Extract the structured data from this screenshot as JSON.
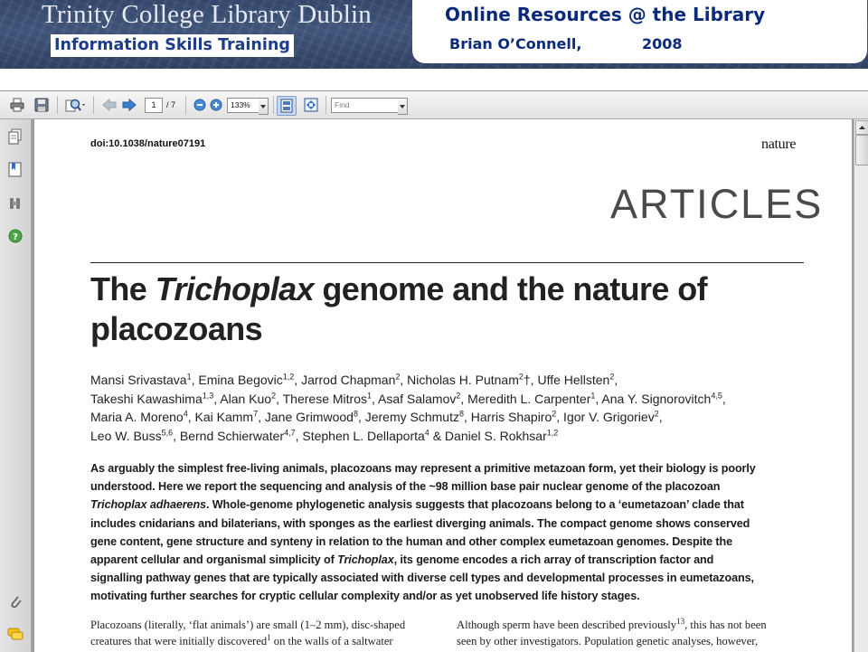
{
  "banner": {
    "title": "Trinity College Library Dublin",
    "subtitle": "Information Skills Training",
    "course_title": "Online Resources @ the Library",
    "author": "Brian O’Connell,",
    "year": "2008"
  },
  "toolbar": {
    "current_page": "1",
    "page_total": "/ 7",
    "zoom": "133%",
    "find_placeholder": "Find"
  },
  "sidebar": {
    "icons": [
      "pages-icon",
      "bookmarks-icon",
      "signatures-icon",
      "help-icon",
      "attachments-icon",
      "comments-icon"
    ]
  },
  "article": {
    "doi": "doi:10.1038/nature07191",
    "journal": "nature",
    "section": "ARTICLES",
    "title_1": "The ",
    "title_italic": "Trichoplax",
    "title_2": " genome and the nature of",
    "title_3": "placozoans",
    "authors": [
      [
        {
          "t": "Mansi Srivastava"
        },
        {
          "s": "1"
        },
        {
          "t": ", Emina Begovic"
        },
        {
          "s": "1,2"
        },
        {
          "t": ", Jarrod Chapman"
        },
        {
          "s": "2"
        },
        {
          "t": ", Nicholas H. Putnam"
        },
        {
          "s": "2"
        },
        {
          "t": "†, Uffe Hellsten"
        },
        {
          "s": "2"
        },
        {
          "t": ","
        }
      ],
      [
        {
          "t": "Takeshi Kawashima"
        },
        {
          "s": "1,3"
        },
        {
          "t": ", Alan Kuo"
        },
        {
          "s": "2"
        },
        {
          "t": ", Therese Mitros"
        },
        {
          "s": "1"
        },
        {
          "t": ", Asaf Salamov"
        },
        {
          "s": "2"
        },
        {
          "t": ", Meredith L. Carpenter"
        },
        {
          "s": "1"
        },
        {
          "t": ", Ana Y. Signorovitch"
        },
        {
          "s": "4,5"
        },
        {
          "t": ","
        }
      ],
      [
        {
          "t": "Maria A. Moreno"
        },
        {
          "s": "4"
        },
        {
          "t": ", Kai Kamm"
        },
        {
          "s": "7"
        },
        {
          "t": ", Jane Grimwood"
        },
        {
          "s": "8"
        },
        {
          "t": ", Jeremy Schmutz"
        },
        {
          "s": "8"
        },
        {
          "t": ", Harris Shapiro"
        },
        {
          "s": "2"
        },
        {
          "t": ", Igor V. Grigoriev"
        },
        {
          "s": "2"
        },
        {
          "t": ","
        }
      ],
      [
        {
          "t": "Leo W. Buss"
        },
        {
          "s": "5,6"
        },
        {
          "t": ", Bernd Schierwater"
        },
        {
          "s": "4,7"
        },
        {
          "t": ", Stephen L. Dellaporta"
        },
        {
          "s": "4"
        },
        {
          "t": " & Daniel S. Rokhsar"
        },
        {
          "s": "1,2"
        }
      ]
    ],
    "abstract_lines": [
      [
        {
          "t": "As arguably the simplest free-living animals, placozoans may represent a primitive metazoan form, yet their biology is poorly"
        }
      ],
      [
        {
          "t": "understood. Here we report the sequencing and analysis of the ~98 million base pair nuclear genome of the placozoan"
        }
      ],
      [
        {
          "i": "Trichoplax adhaerens"
        },
        {
          "t": ". Whole-genome phylogenetic analysis suggests that placozoans belong to a ‘eumetazoan’ clade that"
        }
      ],
      [
        {
          "t": "includes cnidarians and bilaterians, with sponges as the earliest diverging animals. The compact genome shows conserved"
        }
      ],
      [
        {
          "t": "gene content, gene structure and synteny in relation to the human and other complex eumetazoan genomes. Despite the"
        }
      ],
      [
        {
          "t": "apparent cellular and organismal simplicity of "
        },
        {
          "i": "Trichoplax"
        },
        {
          "t": ", its genome encodes a rich array of transcription factor and"
        }
      ],
      [
        {
          "t": "signalling pathway genes that are typically associated with diverse cell types and developmental processes in eumetazoans,"
        }
      ],
      [
        {
          "t": "motivating further searches for cryptic cellular complexity and/or as yet unobserved life history stages."
        }
      ]
    ],
    "body_left": [
      [
        {
          "t": "Placozoans (literally, ‘flat animals’) are small (1–2 mm), disc-shaped"
        }
      ],
      [
        {
          "t": "creatures that were initially discovered"
        },
        {
          "s": "1"
        },
        {
          "t": " on the walls of a saltwater"
        }
      ]
    ],
    "body_right": [
      [
        {
          "t": "Although sperm have been described previously"
        },
        {
          "s": "13"
        },
        {
          "t": ", this has not been"
        }
      ],
      [
        {
          "t": "seen by other investigators. Population genetic analyses, however,"
        }
      ]
    ]
  }
}
